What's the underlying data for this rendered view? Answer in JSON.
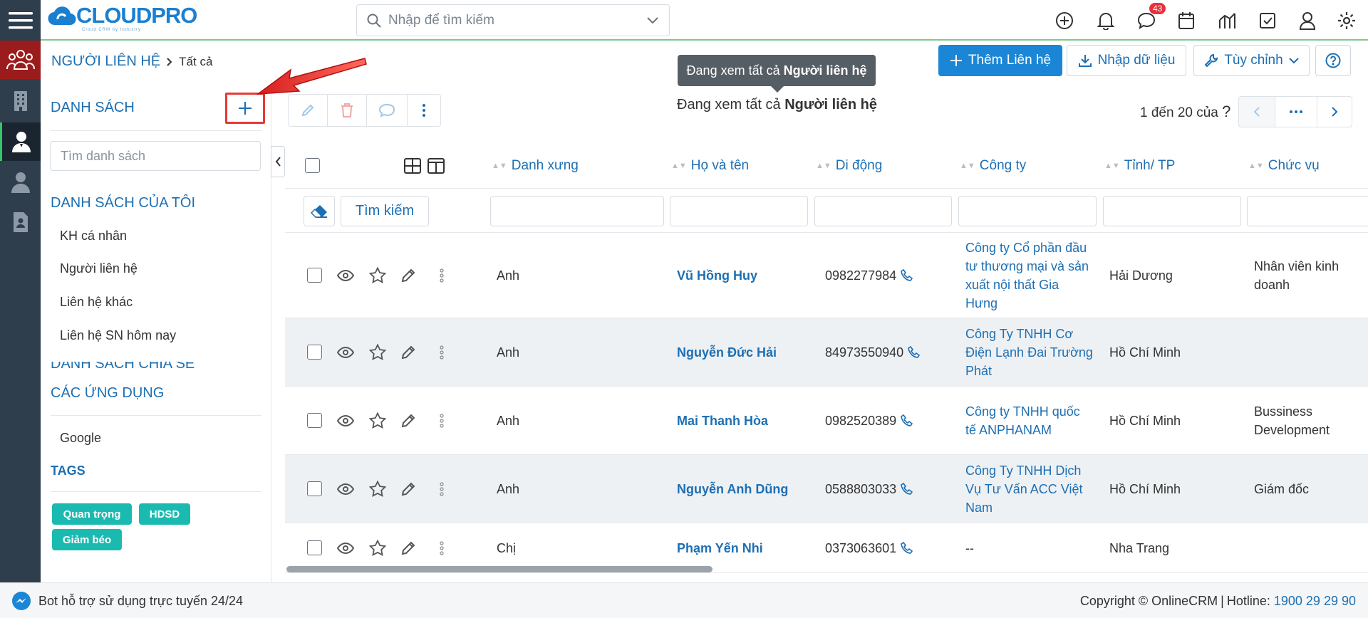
{
  "header": {
    "brand": "CLOUDPRO",
    "brand_tagline": "Cloud CRM by Industry",
    "search_placeholder": "Nhập để tìm kiếm",
    "notification_count": "43"
  },
  "breadcrumb": {
    "module": "NGƯỜI LIÊN HỆ",
    "current": "Tất cả"
  },
  "actions": {
    "add": "Thêm Liên hệ",
    "import": "Nhập dữ liệu",
    "customize": "Tùy chỉnh"
  },
  "tooltip": {
    "prefix": "Đang xem tất cả",
    "bold": "Người liên hệ"
  },
  "viewing": {
    "prefix": "Đang xem tất cả",
    "bold": "Người liên hệ"
  },
  "pager": {
    "text": "1 đến 20 của",
    "q": "?"
  },
  "sidebar": {
    "lists_title": "DANH SÁCH",
    "search_placeholder": "Tìm danh sách",
    "my_lists_title": "DANH SÁCH CỦA TÔI",
    "my_lists": [
      "KH cá nhân",
      "Người liên hệ",
      "Liên hệ khác",
      "Liên hệ SN hôm nay"
    ],
    "shared_title_partial": "DANH SÁCH CHIA SẺ",
    "apps_title": "CÁC ỨNG DỤNG",
    "apps": [
      "Google"
    ],
    "tags_title": "TAGS",
    "tags": [
      "Quan trọng",
      "HDSD",
      "Giảm béo"
    ],
    "tag_color": "#1bbab0"
  },
  "table": {
    "search_button": "Tìm kiếm",
    "columns": [
      "Danh xưng",
      "Họ và tên",
      "Di động",
      "Công ty",
      "Tỉnh/ TP",
      "Chức vụ"
    ],
    "rows": [
      {
        "salutation": "Anh",
        "name": "Vũ Hồng Huy",
        "mobile": "0982277984",
        "company": "Công ty Cổ phần đầu tư thương mại và sản xuất nội thất Gia Hưng",
        "city": "Hải Dương",
        "title": "Nhân viên kinh doanh"
      },
      {
        "salutation": "Anh",
        "name": "Nguyễn Đức Hải",
        "mobile": "84973550940",
        "company": "Công Ty TNHH Cơ Điện Lạnh Đai Trường Phát",
        "city": "Hồ Chí Minh",
        "title": ""
      },
      {
        "salutation": "Anh",
        "name": "Mai Thanh Hòa",
        "mobile": "0982520389",
        "company": "Công ty TNHH quốc tế ANPHANAM",
        "city": "Hồ Chí Minh",
        "title": "Bussiness Development"
      },
      {
        "salutation": "Anh",
        "name": "Nguyễn Anh Dũng",
        "mobile": "0588803033",
        "company": "Công Ty TNHH Dịch Vụ Tư Vấn ACC Việt Nam",
        "city": "Hồ Chí Minh",
        "title": "Giám đốc"
      },
      {
        "salutation": "Chị",
        "name": "Phạm Yến Nhi",
        "mobile": "0373063601",
        "company": "--",
        "city": "Nha Trang",
        "title": ""
      }
    ]
  },
  "footer": {
    "bot": "Bot hỗ trợ sử dụng trực tuyến 24/24",
    "copyright": "Copyright © OnlineCRM",
    "hotline_label": "Hotline:",
    "hotline": "1900 29 29 90"
  },
  "colors": {
    "primary": "#1b86d6",
    "link": "#1d6fb3",
    "rail": "#2f3e4c",
    "rail_active": "#9b1c1c",
    "annotation": "#e53a37"
  }
}
